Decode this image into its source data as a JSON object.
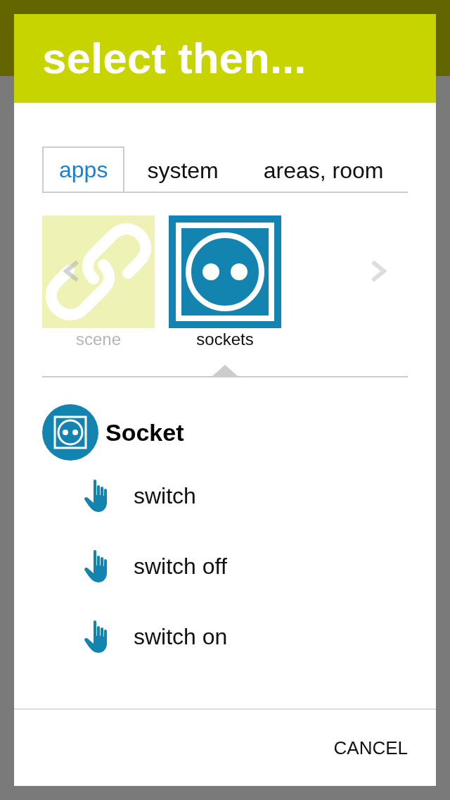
{
  "dialog": {
    "title": "select then..."
  },
  "tabs": [
    {
      "label": "apps",
      "selected": true
    },
    {
      "label": "system",
      "selected": false
    },
    {
      "label": "areas, room",
      "selected": false
    }
  ],
  "carousel": {
    "items": [
      {
        "label": "scene",
        "kind": "link",
        "selected": false
      },
      {
        "label": "sockets",
        "kind": "socket",
        "selected": true
      }
    ]
  },
  "group": {
    "title": "Socket",
    "actions": [
      {
        "label": "switch"
      },
      {
        "label": "switch off"
      },
      {
        "label": "switch on"
      }
    ]
  },
  "buttons": [
    {
      "label": "CANCEL"
    }
  ]
}
